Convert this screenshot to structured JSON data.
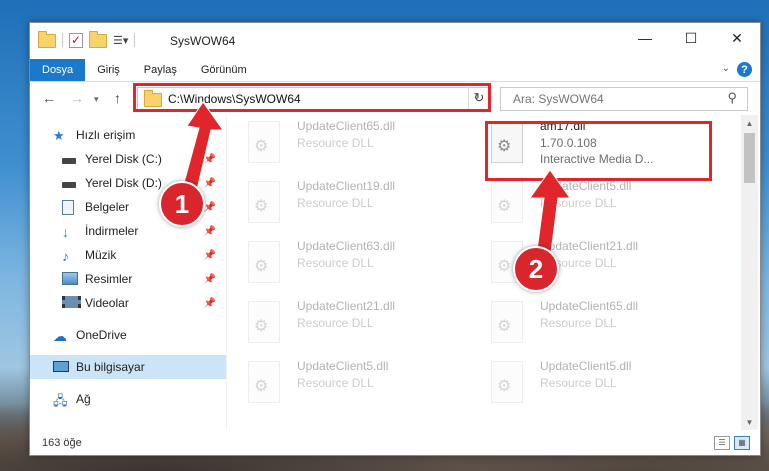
{
  "window": {
    "title": "SysWOW64"
  },
  "window_controls": {
    "minimize": "—",
    "maximize": "☐",
    "close": "✕"
  },
  "ribbon": {
    "tabs": [
      "Dosya",
      "Giriş",
      "Paylaş",
      "Görünüm"
    ],
    "help": "?"
  },
  "address": {
    "path": "C:\\Windows\\SysWOW64"
  },
  "search": {
    "placeholder": "Ara: SysWOW64"
  },
  "sidebar": {
    "items": [
      {
        "label": "Hızlı erişim",
        "icon": "star-icon"
      },
      {
        "label": "Yerel Disk (C:)",
        "icon": "drive-icon",
        "pinned": true
      },
      {
        "label": "Yerel Disk (D:)",
        "icon": "drive-icon",
        "pinned": true
      },
      {
        "label": "Belgeler",
        "icon": "document-icon",
        "pinned": true
      },
      {
        "label": "İndirmeler",
        "icon": "download-icon",
        "pinned": true
      },
      {
        "label": "Müzik",
        "icon": "music-icon",
        "pinned": true
      },
      {
        "label": "Resimler",
        "icon": "pictures-icon",
        "pinned": true
      },
      {
        "label": "Videolar",
        "icon": "video-icon",
        "pinned": true
      },
      {
        "label": "OneDrive",
        "icon": "cloud-icon"
      },
      {
        "label": "Bu bilgisayar",
        "icon": "computer-icon",
        "selected": true
      },
      {
        "label": "Ağ",
        "icon": "network-icon"
      }
    ]
  },
  "files": [
    {
      "name": "UpdateClient65.dll",
      "type": "Resource DLL"
    },
    {
      "name": "am17.dll",
      "version": "1.70.0.108",
      "description": "Interactive Media D..."
    },
    {
      "name": "UpdateClient19.dll",
      "type": "Resource DLL"
    },
    {
      "name": "UpdateClient5.dll",
      "type": "Resource DLL"
    },
    {
      "name": "UpdateClient63.dll",
      "type": "Resource DLL"
    },
    {
      "name": "UpdateClient21.dll",
      "type": "Resource DLL"
    },
    {
      "name": "UpdateClient21.dll",
      "type": "Resource DLL"
    },
    {
      "name": "UpdateClient65.dll",
      "type": "Resource DLL"
    },
    {
      "name": "UpdateClient5.dll",
      "type": "Resource DLL"
    },
    {
      "name": "UpdateClient5.dll",
      "type": "Resource DLL"
    }
  ],
  "status": {
    "count": "163 öğe"
  },
  "annotations": {
    "badge1": "1",
    "badge2": "2",
    "highlight_color": "#e0262a"
  }
}
